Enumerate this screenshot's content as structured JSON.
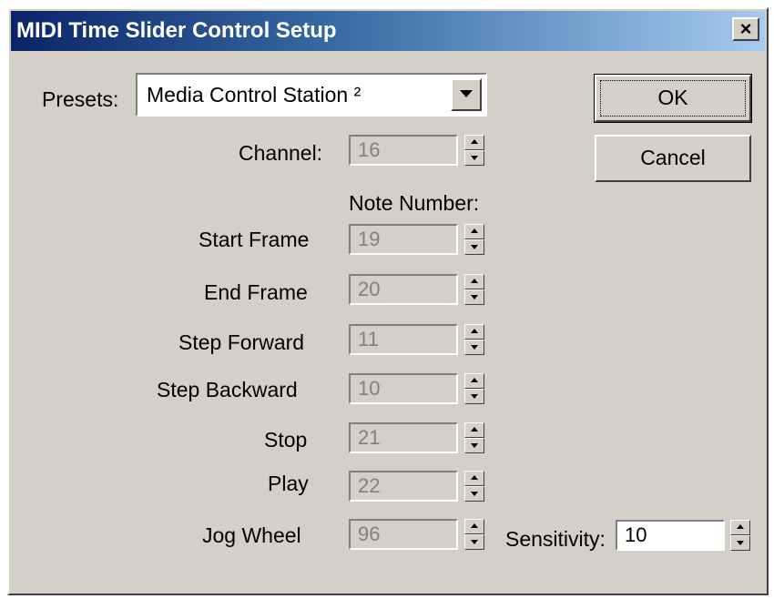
{
  "window": {
    "title": "MIDI Time Slider Control Setup",
    "close_label": "×"
  },
  "presets": {
    "label": "Presets:",
    "value": "Media Control Station ²"
  },
  "buttons": {
    "ok_label": "OK",
    "cancel_label": "Cancel"
  },
  "channel": {
    "label": "Channel:",
    "value": "16"
  },
  "note_number_heading": "Note Number:",
  "notes": [
    {
      "label": "Start Frame",
      "value": "19"
    },
    {
      "label": "End Frame",
      "value": "20"
    },
    {
      "label": "Step Forward",
      "value": "11"
    },
    {
      "label": "Step Backward",
      "value": "10"
    },
    {
      "label": "Stop",
      "value": "21"
    },
    {
      "label": "Play",
      "value": "22"
    },
    {
      "label": "Jog Wheel",
      "value": "96"
    }
  ],
  "sensitivity": {
    "label": "Sensitivity:",
    "value": "10"
  },
  "colors": {
    "title_gradient_start": "#0a246a",
    "title_gradient_end": "#a6caf0",
    "face": "#d4d0c8"
  }
}
